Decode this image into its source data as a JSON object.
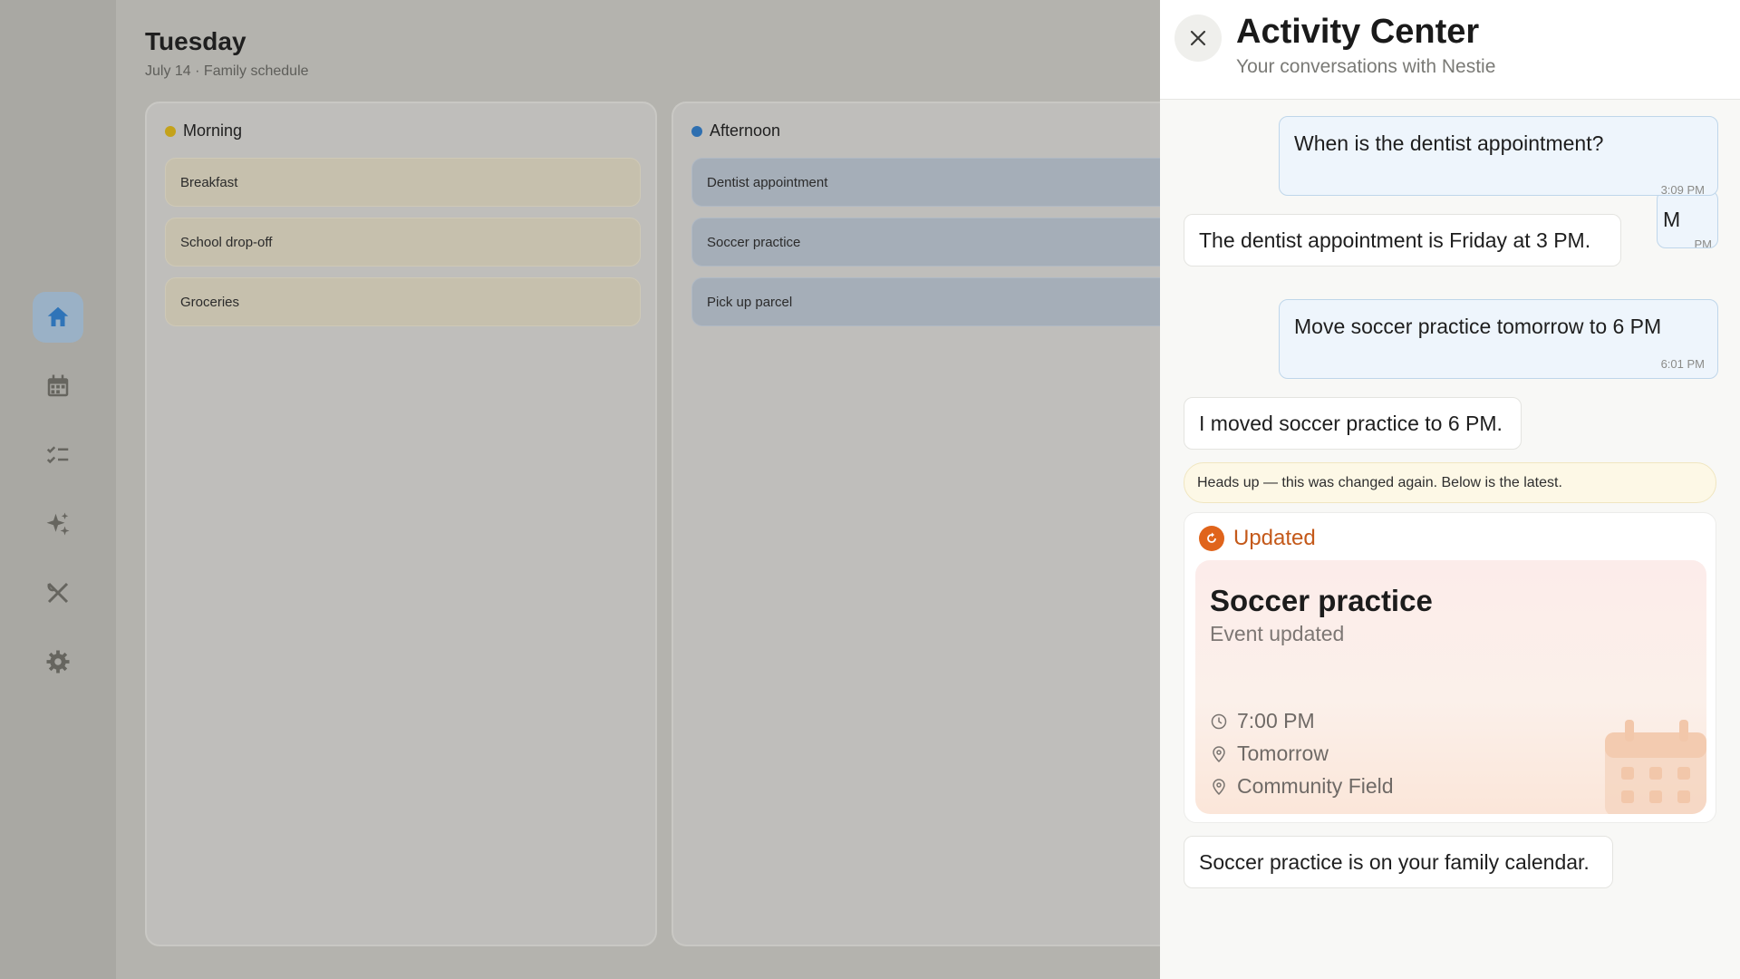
{
  "schedule": {
    "day": "Tuesday",
    "subtitle": "July 14 · Family schedule",
    "columns": [
      {
        "label": "Morning",
        "dot_color": "#c4a21a",
        "tasks": [
          "Breakfast",
          "School drop-off",
          "Groceries"
        ]
      },
      {
        "label": "Afternoon",
        "dot_color": "#2e6fb0",
        "tasks": [
          "Dentist appointment",
          "Soccer practice",
          "Pick up parcel"
        ]
      }
    ]
  },
  "sidebar": {
    "items": [
      {
        "icon": "home-icon",
        "active": true
      },
      {
        "icon": "calendar-icon",
        "active": false
      },
      {
        "icon": "checklist-icon",
        "active": false
      },
      {
        "icon": "sparkle-icon",
        "active": false
      },
      {
        "icon": "utensils-icon",
        "active": false
      },
      {
        "icon": "gear-icon",
        "active": false
      }
    ]
  },
  "panel": {
    "title": "Activity Center",
    "subtitle": "Your conversations with Nestie",
    "messages": [
      {
        "role": "user",
        "text": "When is the dentist appointment?",
        "time": "3:09 PM"
      },
      {
        "role": "user",
        "text": "M",
        "time": "PM"
      },
      {
        "role": "assistant",
        "text": "The dentist appointment is Friday at 3 PM."
      },
      {
        "role": "user",
        "text": "Move soccer practice tomorrow to 6 PM",
        "time": "6:01 PM"
      },
      {
        "role": "assistant",
        "text": "I moved soccer practice to 6 PM."
      },
      {
        "role": "assistant",
        "text": "Soccer practice is on your family calendar."
      }
    ],
    "notice": "Heads up — this was changed again. Below is the latest.",
    "card": {
      "status": "Updated",
      "status_color": "#e0641b",
      "title": "Soccer practice",
      "subtitle": "Event updated",
      "time": "7:00 PM",
      "day": "Tomorrow",
      "location": "Community Field"
    }
  }
}
